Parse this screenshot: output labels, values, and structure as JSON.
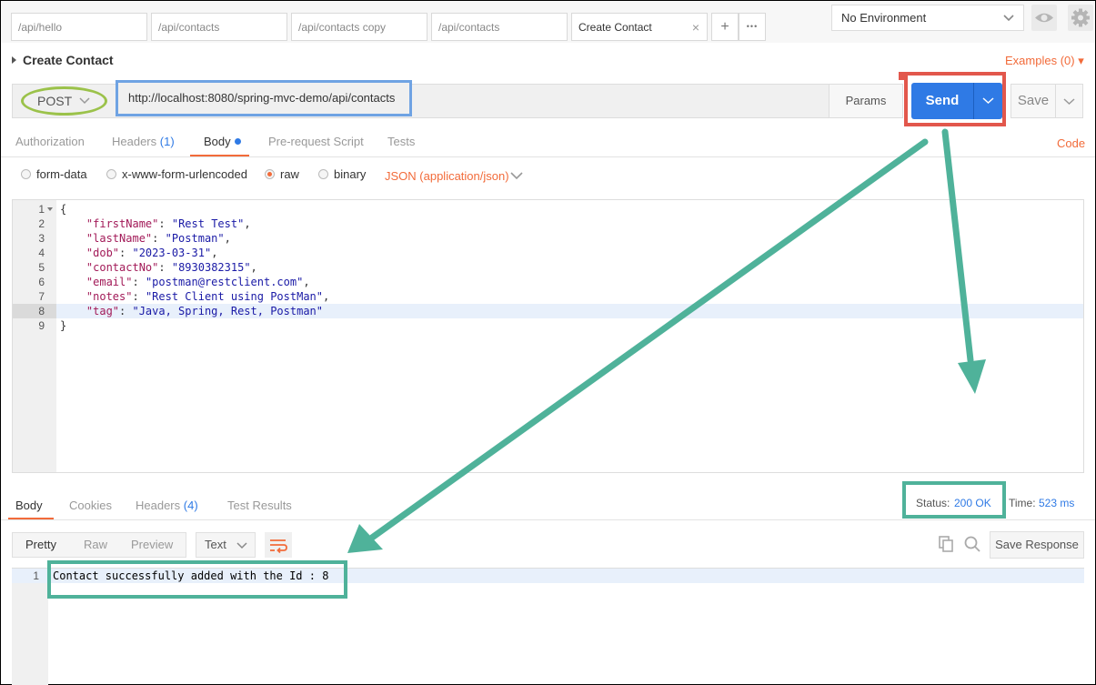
{
  "tabs": [
    {
      "label": "/api/hello",
      "active": false
    },
    {
      "label": "/api/contacts",
      "active": false
    },
    {
      "label": "/api/contacts copy",
      "active": false
    },
    {
      "label": "/api/contacts",
      "active": false
    },
    {
      "label": "Create Contact",
      "active": true
    }
  ],
  "tab_close": "×",
  "tab_add": "+",
  "tab_more": "•••",
  "environment": {
    "selected": "No Environment"
  },
  "request": {
    "name": "Create Contact",
    "examples": "Examples (0)",
    "method": "POST",
    "url": "http://localhost:8080/spring-mvc-demo/api/contacts",
    "params_label": "Params",
    "send_label": "Send",
    "save_label": "Save"
  },
  "request_tabs": {
    "authorization": "Authorization",
    "headers": "Headers",
    "headers_count": "(1)",
    "body": "Body",
    "prerequest": "Pre-request Script",
    "tests": "Tests",
    "code": "Code"
  },
  "body_types": {
    "form_data": "form-data",
    "urlencoded": "x-www-form-urlencoded",
    "raw": "raw",
    "binary": "binary",
    "selected": "raw",
    "content_type": "JSON (application/json)"
  },
  "editor": {
    "lines": [
      {
        "n": "1",
        "text": "{"
      },
      {
        "n": "2",
        "key": "\"firstName\"",
        "val": "\"Rest Test\"",
        "end": ","
      },
      {
        "n": "3",
        "key": "\"lastName\"",
        "val": "\"Postman\"",
        "end": ","
      },
      {
        "n": "4",
        "key": "\"dob\"",
        "val": "\"2023-03-31\"",
        "end": ","
      },
      {
        "n": "5",
        "key": "\"contactNo\"",
        "val": "\"8930382315\"",
        "end": ","
      },
      {
        "n": "6",
        "key": "\"email\"",
        "val": "\"postman@restclient.com\"",
        "end": ","
      },
      {
        "n": "7",
        "key": "\"notes\"",
        "val": "\"Rest Client using PostMan\"",
        "end": ","
      },
      {
        "n": "8",
        "key": "\"tag\"",
        "val": "\"Java, Spring, Rest, Postman\"",
        "end": ""
      },
      {
        "n": "9",
        "text": "}"
      }
    ],
    "highlighted_line": "8"
  },
  "response_tabs": {
    "body": "Body",
    "cookies": "Cookies",
    "headers": "Headers",
    "headers_count": "(4)",
    "test_results": "Test Results"
  },
  "response": {
    "status_label": "Status:",
    "status_value": "200 OK",
    "time_label": "Time:",
    "time_value": "523 ms",
    "formats": {
      "pretty": "Pretty",
      "raw": "Raw",
      "preview": "Preview"
    },
    "text_select": "Text",
    "save_response": "Save Response",
    "line_no": "1",
    "line_text": "Contact successfully added with the Id : 8"
  },
  "colors": {
    "accent_orange": "#f26b3a",
    "send_blue": "#2f7ae5",
    "annotation_green": "#4fb29a",
    "annotation_red": "#e2574c",
    "annotation_blue": "#6fa3e3",
    "annotation_lime": "#9bc24a"
  },
  "icons": [
    "close-icon",
    "plus-icon",
    "more-icon",
    "chevron-down-icon",
    "eye-icon",
    "gear-icon",
    "copy-icon",
    "search-icon",
    "wrap-lines-icon"
  ]
}
